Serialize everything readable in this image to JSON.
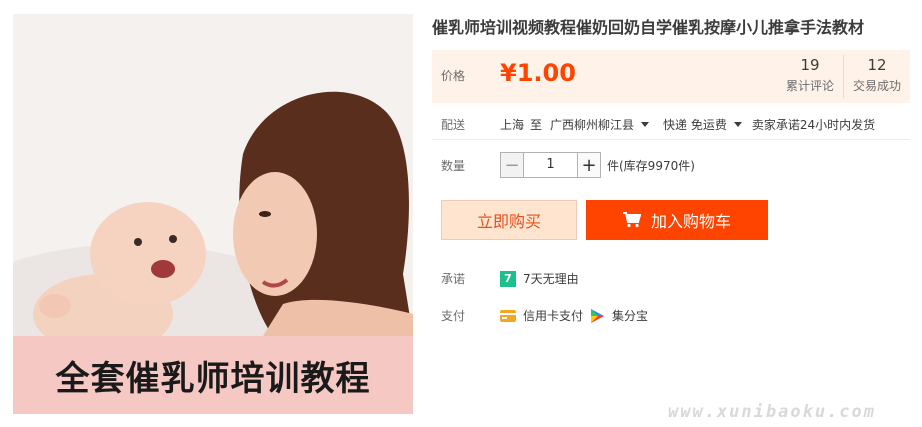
{
  "product": {
    "title": "催乳师培训视频教程催奶回奶自学催乳按摩小儿推拿手法教材",
    "image_banner": "全套催乳师培训教程"
  },
  "price": {
    "label": "价格",
    "value": "¥1.00"
  },
  "stats": {
    "reviews_count": "19",
    "reviews_label": "累计评论",
    "deals_count": "12",
    "deals_label": "交易成功"
  },
  "shipping": {
    "label": "配送",
    "from": "上海",
    "to_word": "至",
    "destination": "广西柳州柳江县",
    "method": "快递 免运费",
    "promise": "卖家承诺24小时内发货"
  },
  "quantity": {
    "label": "数量",
    "minus": "−",
    "value": "1",
    "plus": "+",
    "stock": "件(库存9970件)"
  },
  "actions": {
    "buy_now": "立即购买",
    "add_to_cart": "加入购物车"
  },
  "promise": {
    "label": "承诺",
    "icon_text": "7",
    "text": "7天无理由"
  },
  "payment": {
    "label": "支付",
    "credit_card": "信用卡支付",
    "jifenbao": "集分宝"
  },
  "watermark": "www.xunibaoku.com",
  "colors": {
    "accent": "#ff4400",
    "price_bg": "#fff2e8",
    "banner_bg": "#f6c8c4",
    "promise_green": "#1dbf8c"
  }
}
